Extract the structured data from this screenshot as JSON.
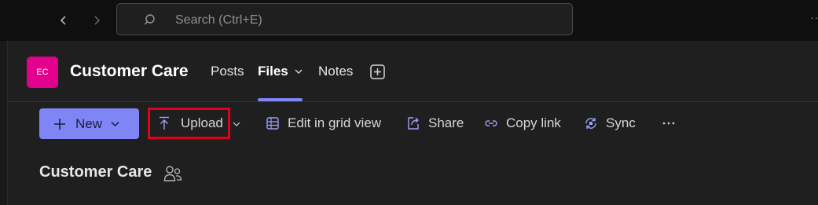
{
  "titlebar": {
    "search": {
      "placeholder": "Search (Ctrl+E)"
    },
    "icons": {
      "back": "chevron-left-icon",
      "forward": "chevron-right-icon",
      "search": "search-icon"
    }
  },
  "header": {
    "avatar_initials": "EC",
    "avatar_color": "#e3008c",
    "team_name": "Customer Care",
    "tabs": [
      {
        "label": "Posts",
        "active": false
      },
      {
        "label": "Files",
        "active": true
      },
      {
        "label": "Notes",
        "active": false
      }
    ],
    "accent_color": "#7f85f5"
  },
  "toolbar": {
    "new_label": "New",
    "upload_label": "Upload",
    "grid_label": "Edit in grid view",
    "share_label": "Share",
    "copylink_label": "Copy link",
    "sync_label": "Sync",
    "highlight_color": "#e3001b"
  },
  "content": {
    "section_title": "Customer Care"
  }
}
